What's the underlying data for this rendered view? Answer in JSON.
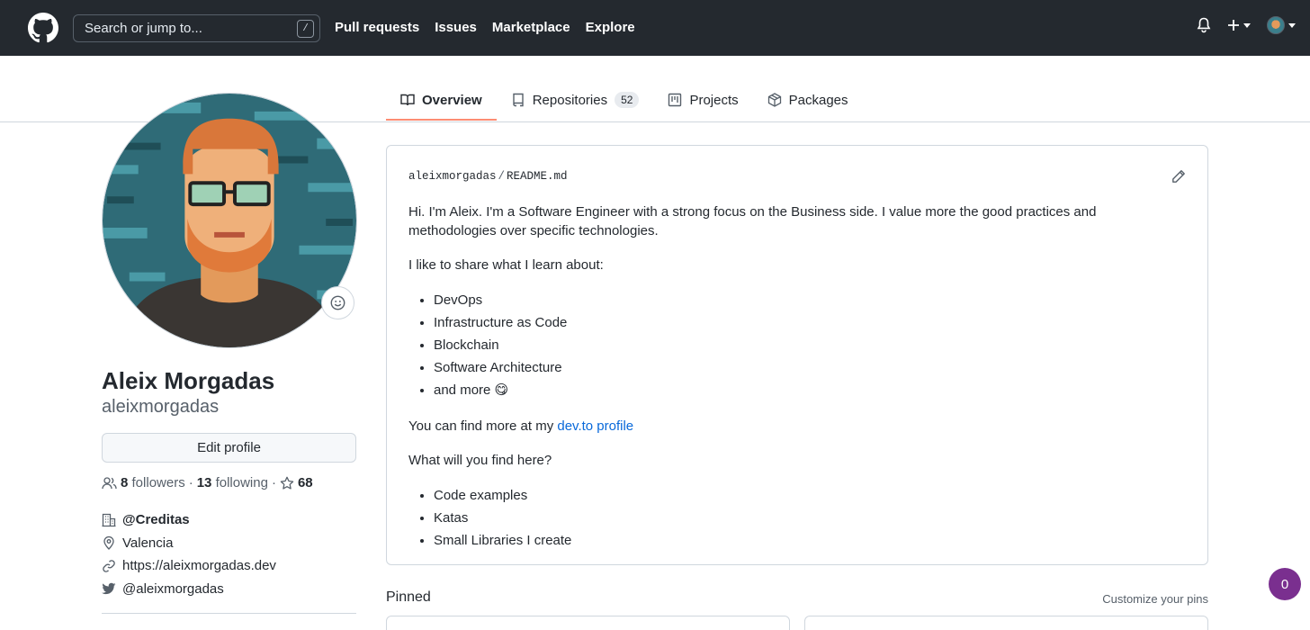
{
  "header": {
    "search_placeholder": "Search or jump to...",
    "search_shortcut": "/",
    "nav": [
      "Pull requests",
      "Issues",
      "Marketplace",
      "Explore"
    ]
  },
  "tabs": [
    {
      "label": "Overview",
      "active": true
    },
    {
      "label": "Repositories",
      "count": "52"
    },
    {
      "label": "Projects"
    },
    {
      "label": "Packages"
    }
  ],
  "profile": {
    "full_name": "Aleix Morgadas",
    "username": "aleixmorgadas",
    "edit_label": "Edit profile",
    "followers_count": "8",
    "followers_label": "followers",
    "following_count": "13",
    "following_label": "following",
    "stars": "68",
    "organization": "@Creditas",
    "location": "Valencia",
    "website": "https://aleixmorgadas.dev",
    "twitter": "@aleixmorgadas"
  },
  "readme": {
    "owner": "aleixmorgadas",
    "file": "README.md",
    "intro": "Hi. I'm Aleix. I'm a Software Engineer with a strong focus on the Business side. I value more the good practices and methodologies over specific technologies.",
    "share_heading": "I like to share what I learn about:",
    "topics": [
      "DevOps",
      "Infrastructure as Code",
      "Blockchain",
      "Software Architecture",
      "and more 😋"
    ],
    "more_prefix": "You can find more at my ",
    "more_link": "dev.to profile",
    "find_heading": "What will you find here?",
    "finds": [
      "Code examples",
      "Katas",
      "Small Libraries I create"
    ]
  },
  "pinned": {
    "title": "Pinned",
    "customize": "Customize your pins"
  },
  "notification_badge": "0",
  "colors": {
    "header_bg": "#24292f",
    "tab_underline": "#fd8c73",
    "link": "#0969da",
    "badge": "#7a2f8f"
  }
}
